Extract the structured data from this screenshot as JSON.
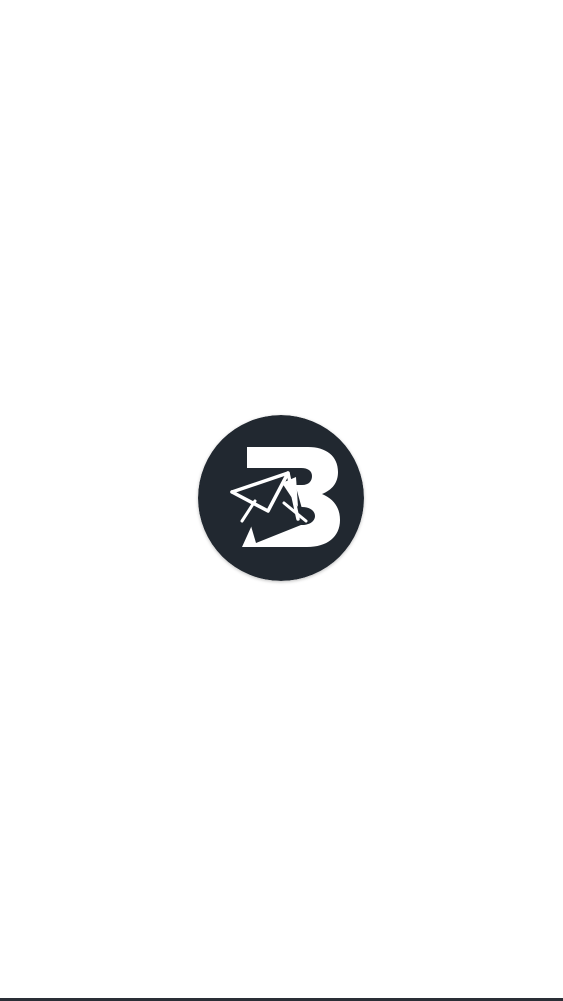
{
  "app": {
    "logo_icon": "envelope-b-logo-icon",
    "colors": {
      "background": "#ffffff",
      "logo_circle": "#212830",
      "logo_mark": "#ffffff",
      "bottom_edge": "#2a2f36"
    }
  }
}
